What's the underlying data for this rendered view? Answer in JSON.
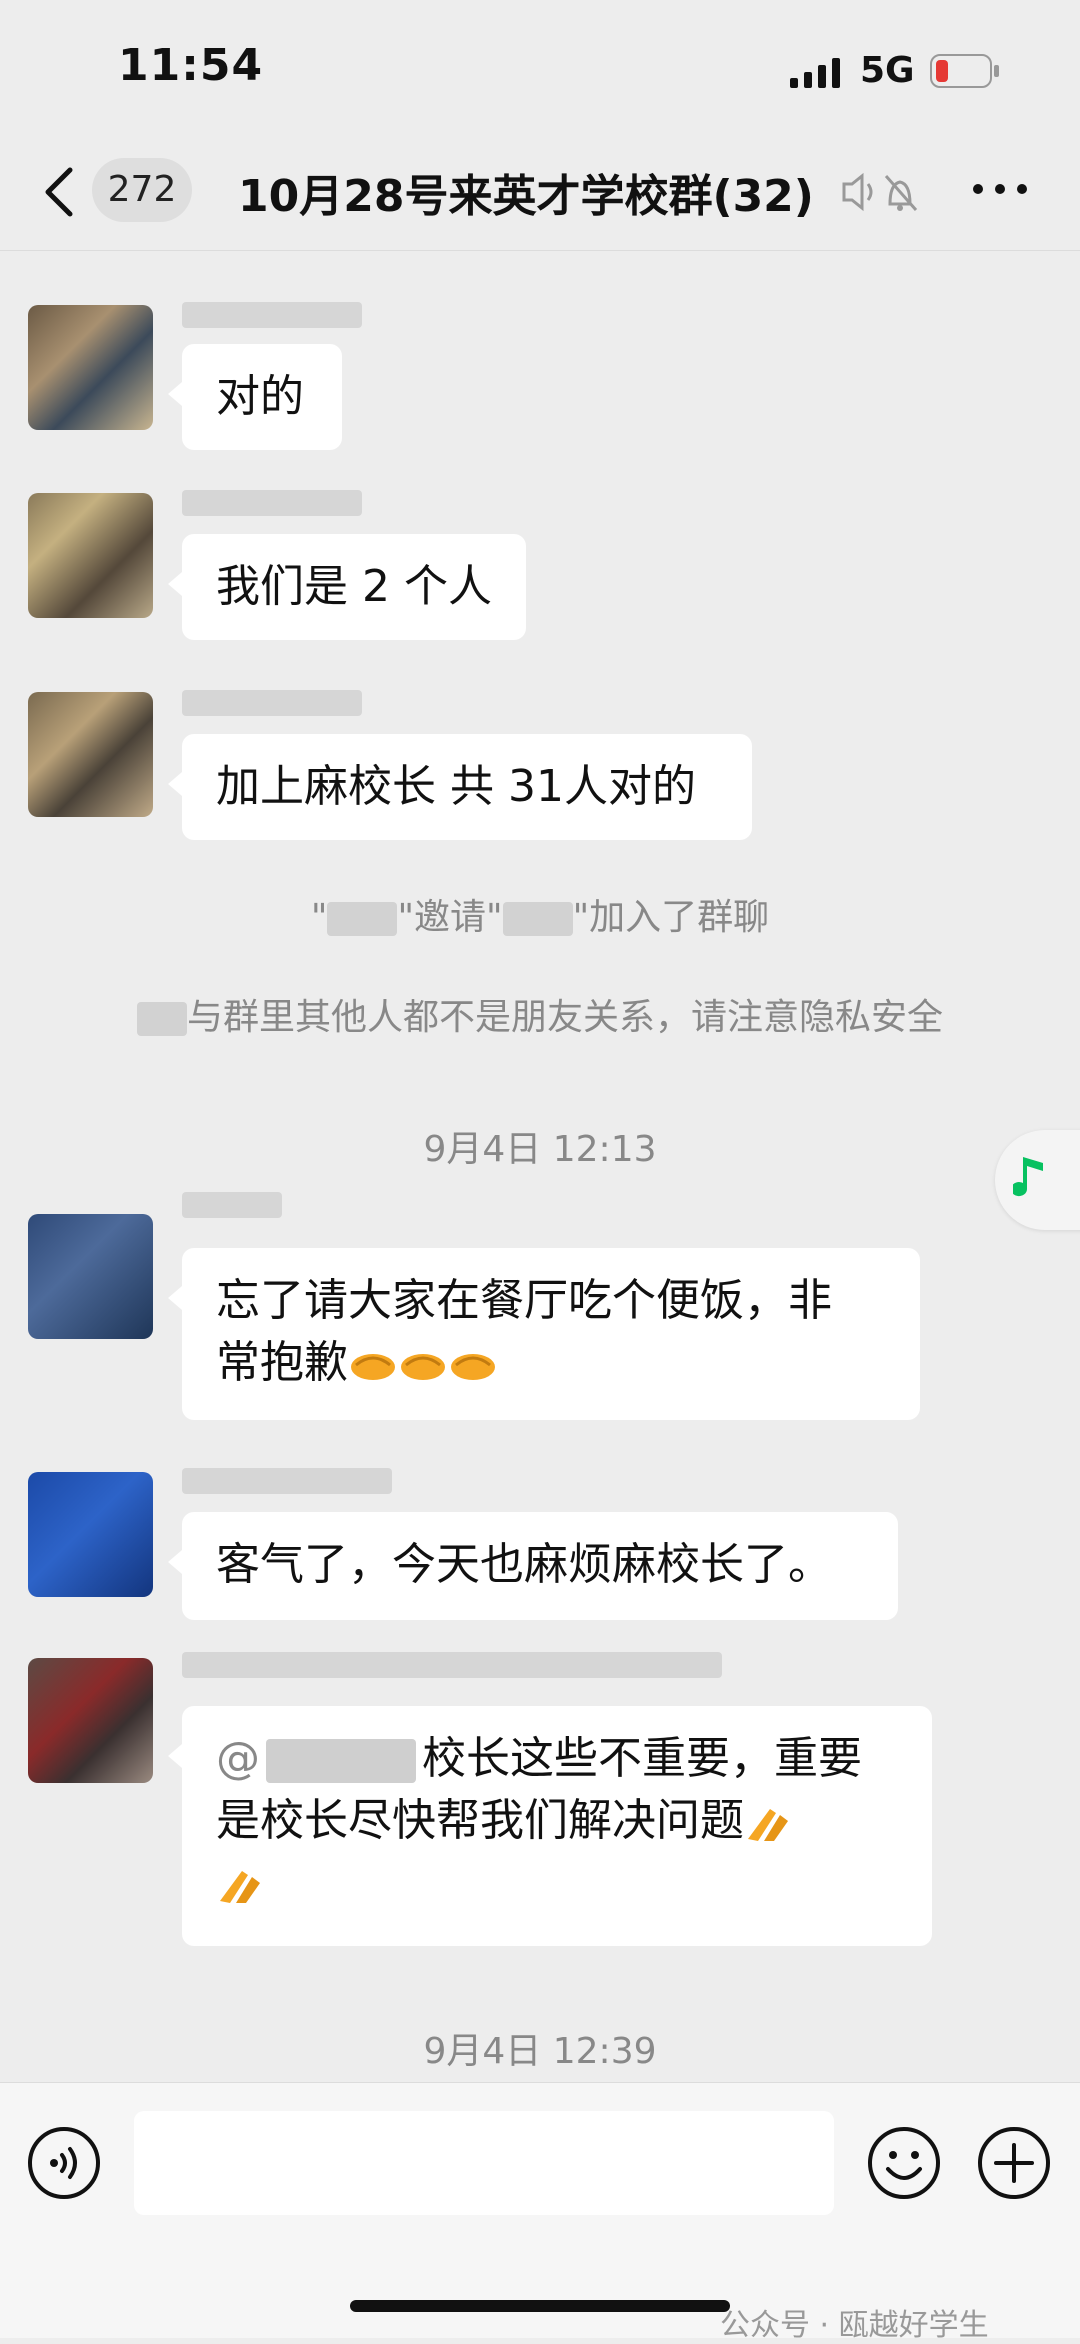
{
  "status_bar": {
    "time": "11:54",
    "network": "5G"
  },
  "nav": {
    "unread_count": "272",
    "title": "10月28号来英才学校群(32)"
  },
  "messages": [
    {
      "text": "对的"
    },
    {
      "text": "我们是 2 个人"
    },
    {
      "text": "加上麻校长 共 31人对的"
    }
  ],
  "system": {
    "invite_left": "\"",
    "invite_mid": "\"邀请\"",
    "invite_right": "\"加入了群聊",
    "privacy_note": "与群里其他人都不是朋友关系，请注意隐私安全",
    "timestamp_1": "9月4日 12:13",
    "timestamp_2": "9月4日 12:39"
  },
  "messages_2": [
    {
      "text_line1": "忘了请大家在餐厅吃个便饭，非",
      "text_line2": "常抱歉"
    },
    {
      "text": "客气了，今天也麻烦麻校长了。"
    },
    {
      "mention_prefix": "@",
      "text_line1": "校长这些不重要，重要",
      "text_line2": "是校长尽快帮我们解决问题"
    }
  ],
  "input": {
    "placeholder": ""
  },
  "footer": {
    "watermark": "公众号 · 瓯越好学生"
  },
  "colors": {
    "background": "#ededed",
    "bubble": "#ffffff",
    "battery_low": "#e53935",
    "music_green": "#07c160"
  }
}
